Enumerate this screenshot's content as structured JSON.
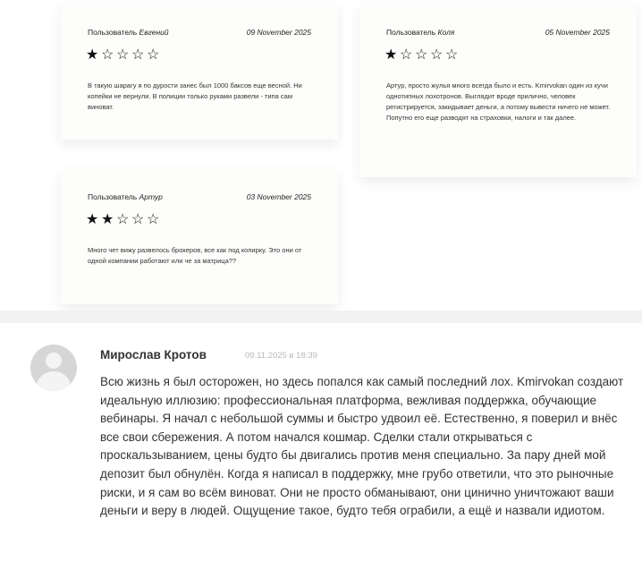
{
  "reviews": [
    {
      "user_prefix": "Пользователь",
      "user_name": "Евгений",
      "date": "09 November 2025",
      "rating": 1,
      "text": "В такую шарагу я по дурости занес был 1000 баксов еще весной. Ни копейки не вернули. В полиции только руками развели - типа сам виноват."
    },
    {
      "user_prefix": "Пользователь",
      "user_name": "Коля",
      "date": "05 November 2025",
      "rating": 1,
      "text": "Артур, просто жулья много всегда было и есть. Kmirvokan один из кучи однотипных лохотронов. Выглядит вроде прилично, человек регистрируется, закидывает деньги, а потому вывести ничего не может. Попутно его еще разводят на страховки, налоги и так далее."
    },
    {
      "user_prefix": "Пользователь",
      "user_name": "Артур",
      "date": "03 November 2025",
      "rating": 2,
      "text": "Много чет вижу развелось брокеров, все как под копирку. Это они от одной компании работают или че за матрица??"
    }
  ],
  "comment": {
    "author": "Мирослав Кротов",
    "timestamp": "09.11.2025 в 18:39",
    "text": "Всю жизнь я был осторожен, но здесь попался как самый последний лох. Kmirvokan создают идеальную иллюзию: профессиональная платформа, вежливая поддержка, обучающие вебинары. Я начал с небольшой суммы и быстро удвоил её. Естественно, я поверил и внёс все свои сбережения. А потом начался кошмар. Сделки стали открываться с проскальзыванием, цены будто бы двигались против меня специально. За пару дней мой депозит был обнулён. Когда я написал в поддержку, мне грубо ответили, что это рыночные риски, и я сам во всём виноват. Они не просто обманывают, они цинично уничтожают ваши деньги и веру в людей. Ощущение такое, будто тебя ограбили, а ещё и назвали идиотом."
  }
}
